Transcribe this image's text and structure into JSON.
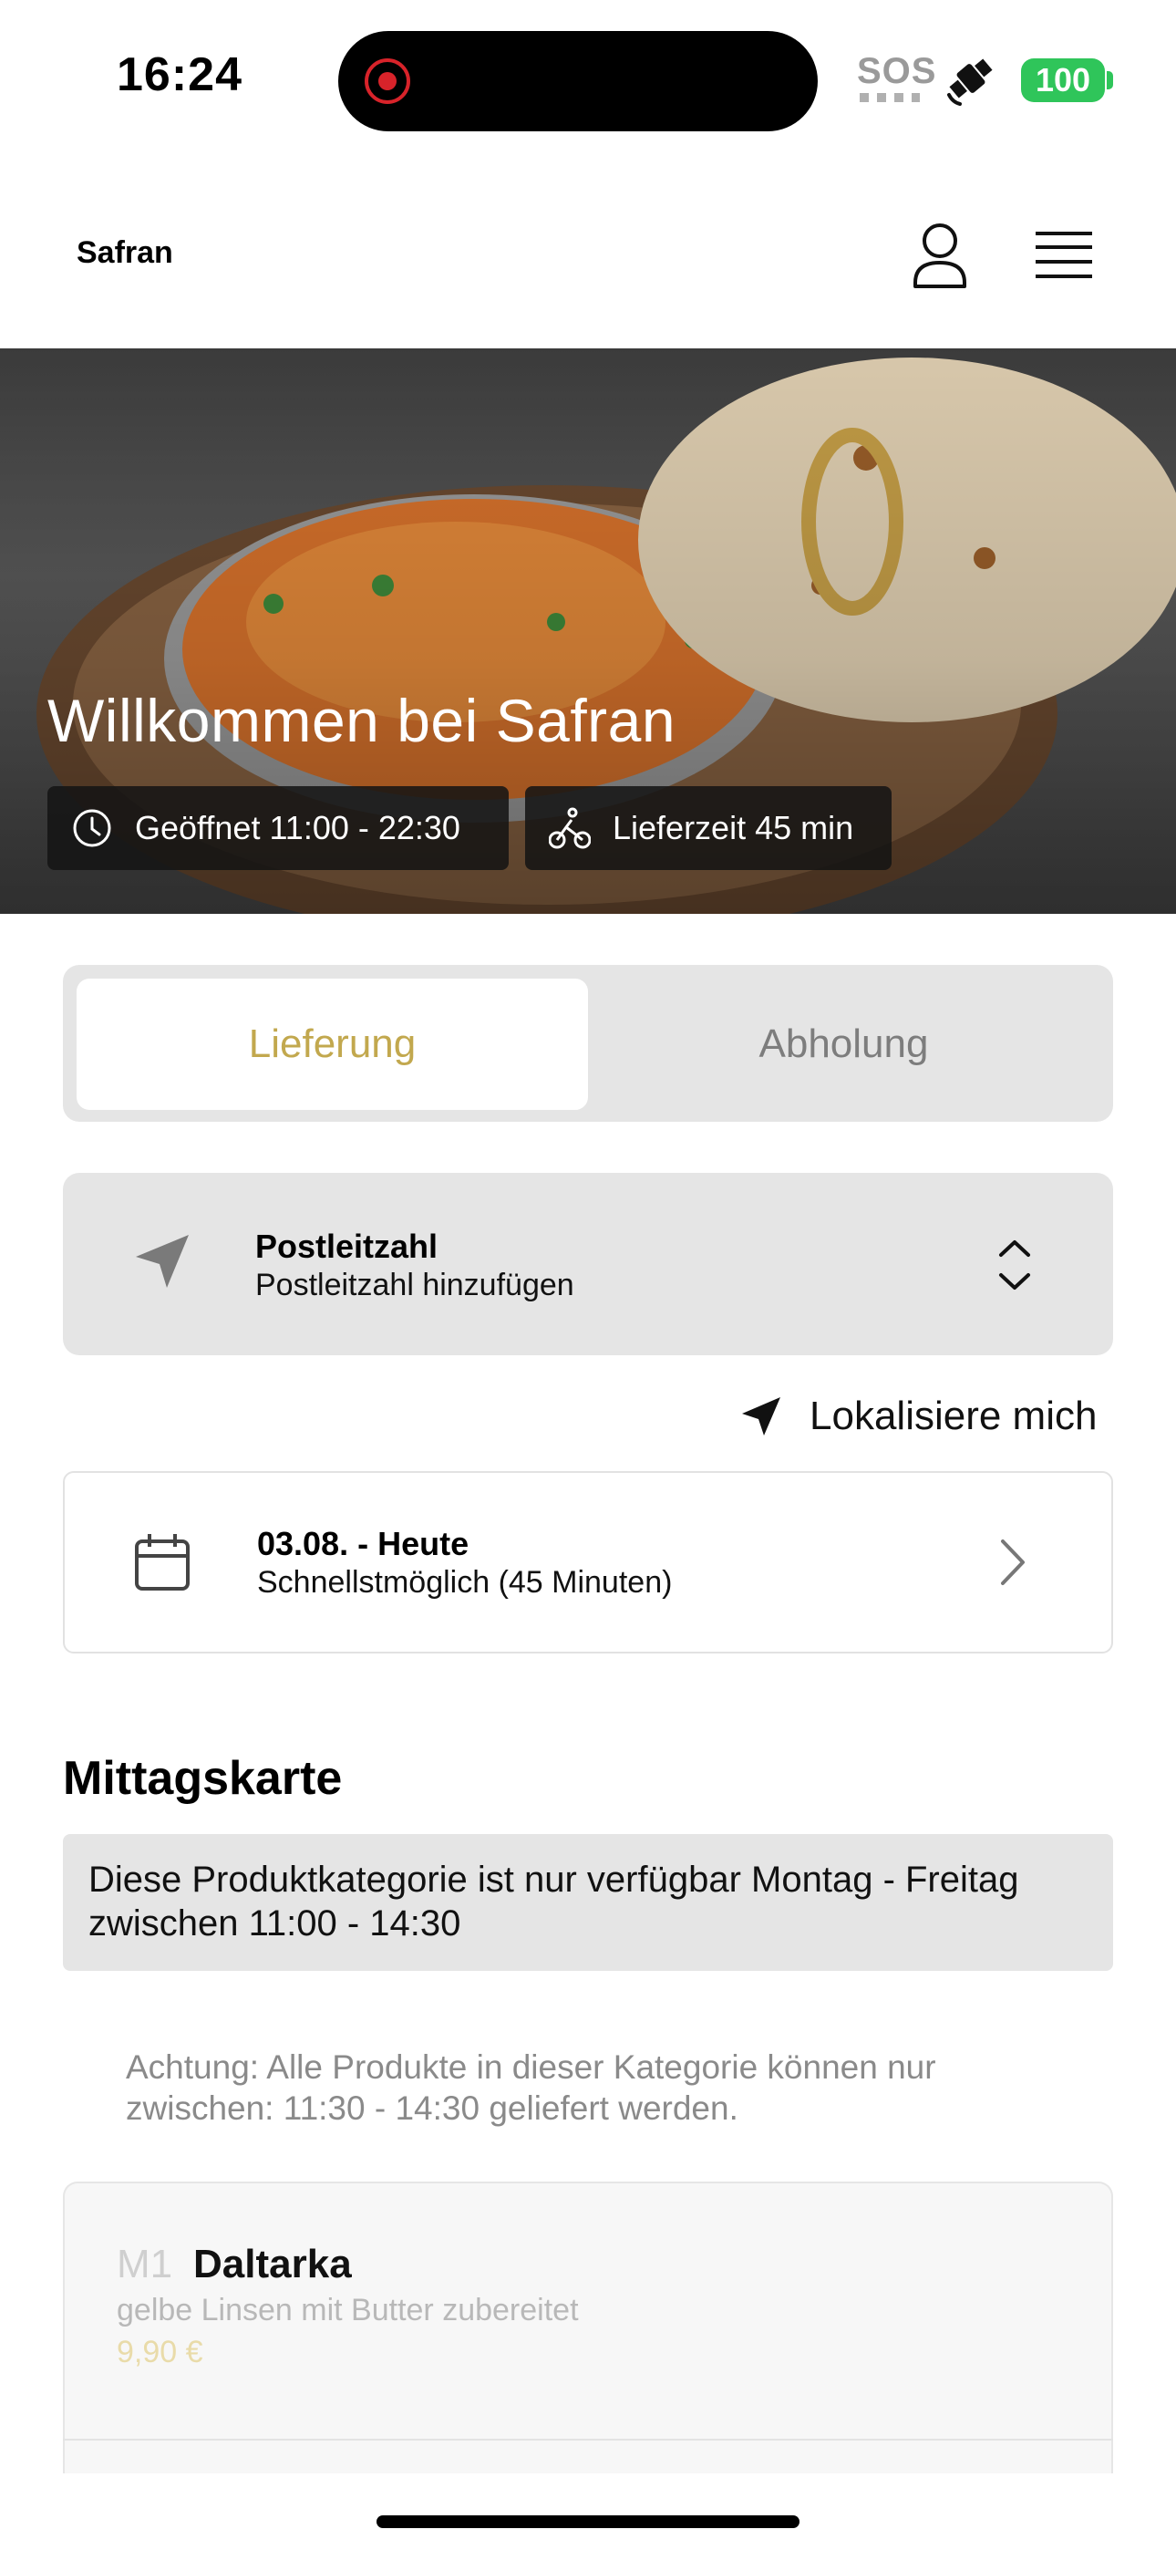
{
  "status_bar": {
    "time": "16:24",
    "sos": "SOS",
    "battery": "100"
  },
  "header": {
    "brand": "Safran",
    "icons": [
      "user-icon",
      "menu-icon"
    ]
  },
  "hero": {
    "title": "Willkommen bei Safran",
    "opening_hours": "Geöffnet 11:00 - 22:30",
    "delivery_time": "Lieferzeit 45 min"
  },
  "order_mode": {
    "options": [
      "Lieferung",
      "Abholung"
    ],
    "selected": "Lieferung"
  },
  "postcode": {
    "title": "Postleitzahl",
    "placeholder": "Postleitzahl hinzufügen"
  },
  "locate_me": "Lokalisiere mich",
  "schedule": {
    "date": "03.08. - Heute",
    "time": "Schnellstmöglich (45 Minuten)"
  },
  "menu_section": {
    "title": "Mittagskarte",
    "availability": "Diese Produktkategorie ist nur verfügbar Montag - Freitag zwischen 11:00 - 14:30",
    "warning": "Achtung: Alle Produkte in dieser Kategorie können nur zwischen: 11:30 - 14:30 geliefert werden."
  },
  "products": [
    {
      "code": "M1",
      "name": "Daltarka",
      "description": "gelbe Linsen mit Butter zubereitet",
      "price": "9,90 €"
    }
  ],
  "colors": {
    "accent": "#c2a84e",
    "card_bg": "#e5e5e5",
    "battery": "#2fc55a",
    "record": "#d8232a"
  }
}
